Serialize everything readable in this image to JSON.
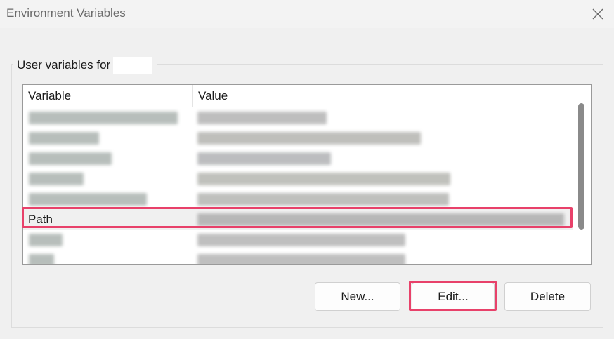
{
  "window": {
    "title": "Environment Variables"
  },
  "group": {
    "label": "User variables for"
  },
  "table": {
    "columns": [
      "Variable",
      "Value"
    ],
    "rows": [
      {
        "variable": "",
        "value": "",
        "redacted": true
      },
      {
        "variable": "",
        "value": "",
        "redacted": true
      },
      {
        "variable": "",
        "value": "",
        "redacted": true
      },
      {
        "variable": "",
        "value": "",
        "redacted": true
      },
      {
        "variable": "",
        "value": "",
        "redacted": true
      },
      {
        "variable": "Path",
        "value": "",
        "redacted_value": true,
        "selected": true
      },
      {
        "variable": "",
        "value": "",
        "redacted": true
      },
      {
        "variable": "",
        "value": "",
        "redacted": true
      }
    ]
  },
  "buttons": {
    "new": "New...",
    "edit": "Edit...",
    "delete": "Delete"
  },
  "colors": {
    "highlight": "#e8416a",
    "selection": "#f0f0f0"
  },
  "icons": {
    "close": "close-icon"
  }
}
